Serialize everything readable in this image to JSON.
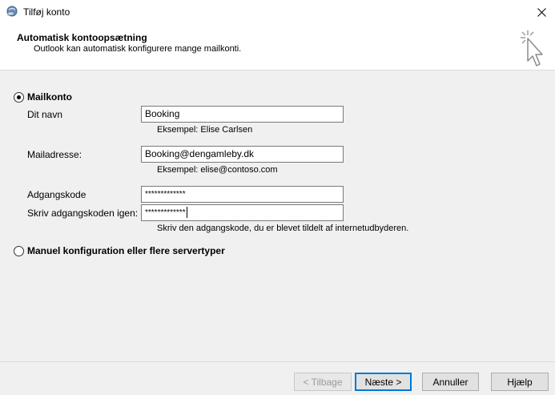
{
  "window": {
    "title": "Tilføj konto",
    "close_icon": "close-icon"
  },
  "header": {
    "title": "Automatisk kontoopsætning",
    "subtitle": "Outlook kan automatisk konfigurere mange mailkonti."
  },
  "mail_account": {
    "radio_label": "Mailkonto",
    "name_label": "Dit navn",
    "name_value": "Booking",
    "name_hint": "Eksempel: Elise Carlsen",
    "email_label": "Mailadresse:",
    "email_value": "Booking@dengamleby.dk",
    "email_hint": "Eksempel: elise@contoso.com",
    "password_label": "Adgangskode",
    "password_value": "*************",
    "password_again_label": "Skriv adgangskoden igen:",
    "password_again_value": "*************",
    "password_hint": "Skriv den adgangskode, du er blevet tildelt af internetudbyderen."
  },
  "manual": {
    "radio_label": "Manuel konfiguration eller flere servertyper"
  },
  "footer": {
    "back": "< Tilbage",
    "next": "Næste >",
    "cancel": "Annuller",
    "help": "Hjælp"
  }
}
